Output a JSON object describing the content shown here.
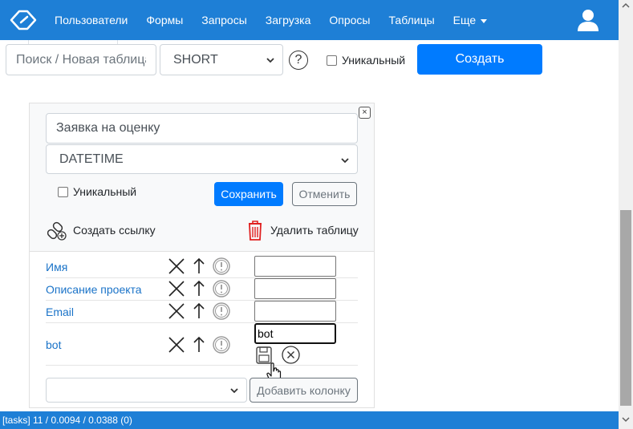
{
  "nav": {
    "items": [
      {
        "label": "Пользователи"
      },
      {
        "label": "Формы"
      },
      {
        "label": "Запросы"
      },
      {
        "label": "Загрузка"
      },
      {
        "label": "Опросы"
      },
      {
        "label": "Таблицы"
      },
      {
        "label": "Еще"
      }
    ]
  },
  "toolbar": {
    "search_placeholder": "Поиск / Новая таблица",
    "type_value": "SHORT",
    "help_glyph": "?",
    "unique_label": "Уникальный",
    "create_label": "Создать"
  },
  "editor": {
    "name_value": "Заявка на оценку",
    "type_value": "DATETIME",
    "unique_label": "Уникальный",
    "save_label": "Сохранить",
    "cancel_label": "Отменить",
    "create_link_label": "Создать ссылку",
    "delete_table_label": "Удалить таблицу",
    "close_glyph": "×"
  },
  "columns": [
    {
      "name": "Имя",
      "value": ""
    },
    {
      "name": "Описание проекта",
      "value": ""
    },
    {
      "name": "Email",
      "value": ""
    },
    {
      "name": "bot",
      "value": "bot"
    }
  ],
  "add_column": {
    "select_value": "",
    "button_label": "Добавить колонку"
  },
  "status": {
    "text": "[tasks] 11 / 0.0094 / 0.0388 (0)"
  },
  "colors": {
    "navbar": "#1e7fd6",
    "primary": "#007bff",
    "link": "#1a73c8",
    "delete": "#e02020"
  }
}
